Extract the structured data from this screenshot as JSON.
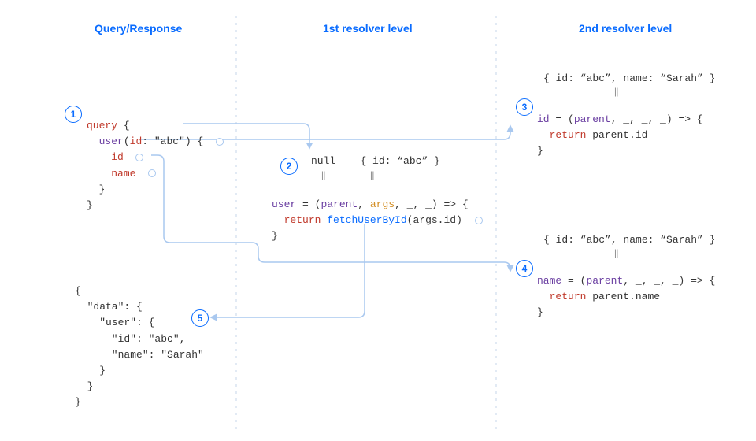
{
  "headers": {
    "col1": "Query/Response",
    "col2": "1st resolver level",
    "col3": "2nd resolver level"
  },
  "badges": {
    "b1": "1",
    "b2": "2",
    "b3": "3",
    "b4": "4",
    "b5": "5"
  },
  "query": {
    "l1_kw": "query",
    "l1_rest": " {",
    "l2_fn": "user",
    "l2_open": "(",
    "l2_arg": "id",
    "l2_mid": ": ",
    "l2_val": "\"abc\"",
    "l2_close": ") {",
    "l3": "id",
    "l4": "name",
    "l5": "}",
    "l6": "}"
  },
  "resolver1": {
    "top_null": "null",
    "top_obj": "{ id: “abc” }",
    "qmark": "||",
    "sig_name": "user",
    "sig_eq": " = (",
    "sig_parent": "parent",
    "sig_c1": ", ",
    "sig_args": "args",
    "sig_rest": ", _, _) => {",
    "ret_kw": "return",
    "ret_fn": "fetchUserById",
    "ret_open": "(",
    "ret_arg": "args.id",
    "ret_close": ")",
    "close": "}"
  },
  "resolver2a": {
    "top_obj": "{ id: “abc”, name: “Sarah” }",
    "qmark": "||",
    "sig_name": "id",
    "sig_eq": " = (",
    "sig_parent": "parent",
    "sig_rest": ", _, _, _) => {",
    "ret_kw": "return",
    "ret_val": "parent.id",
    "close": "}"
  },
  "resolver2b": {
    "top_obj": "{ id: “abc”, name: “Sarah” }",
    "qmark": "||",
    "sig_name": "name",
    "sig_eq": " = (",
    "sig_parent": "parent",
    "sig_rest": ", _, _, _) => {",
    "ret_kw": "return",
    "ret_val": "parent.name",
    "close": "}"
  },
  "response": {
    "l1": "{",
    "l2": "  \"data\": {",
    "l3": "    \"user\": {",
    "l4": "      \"id\": \"abc\",",
    "l5": "      \"name\": \"Sarah\"",
    "l6": "    }",
    "l7": "  }",
    "l8": "}"
  }
}
